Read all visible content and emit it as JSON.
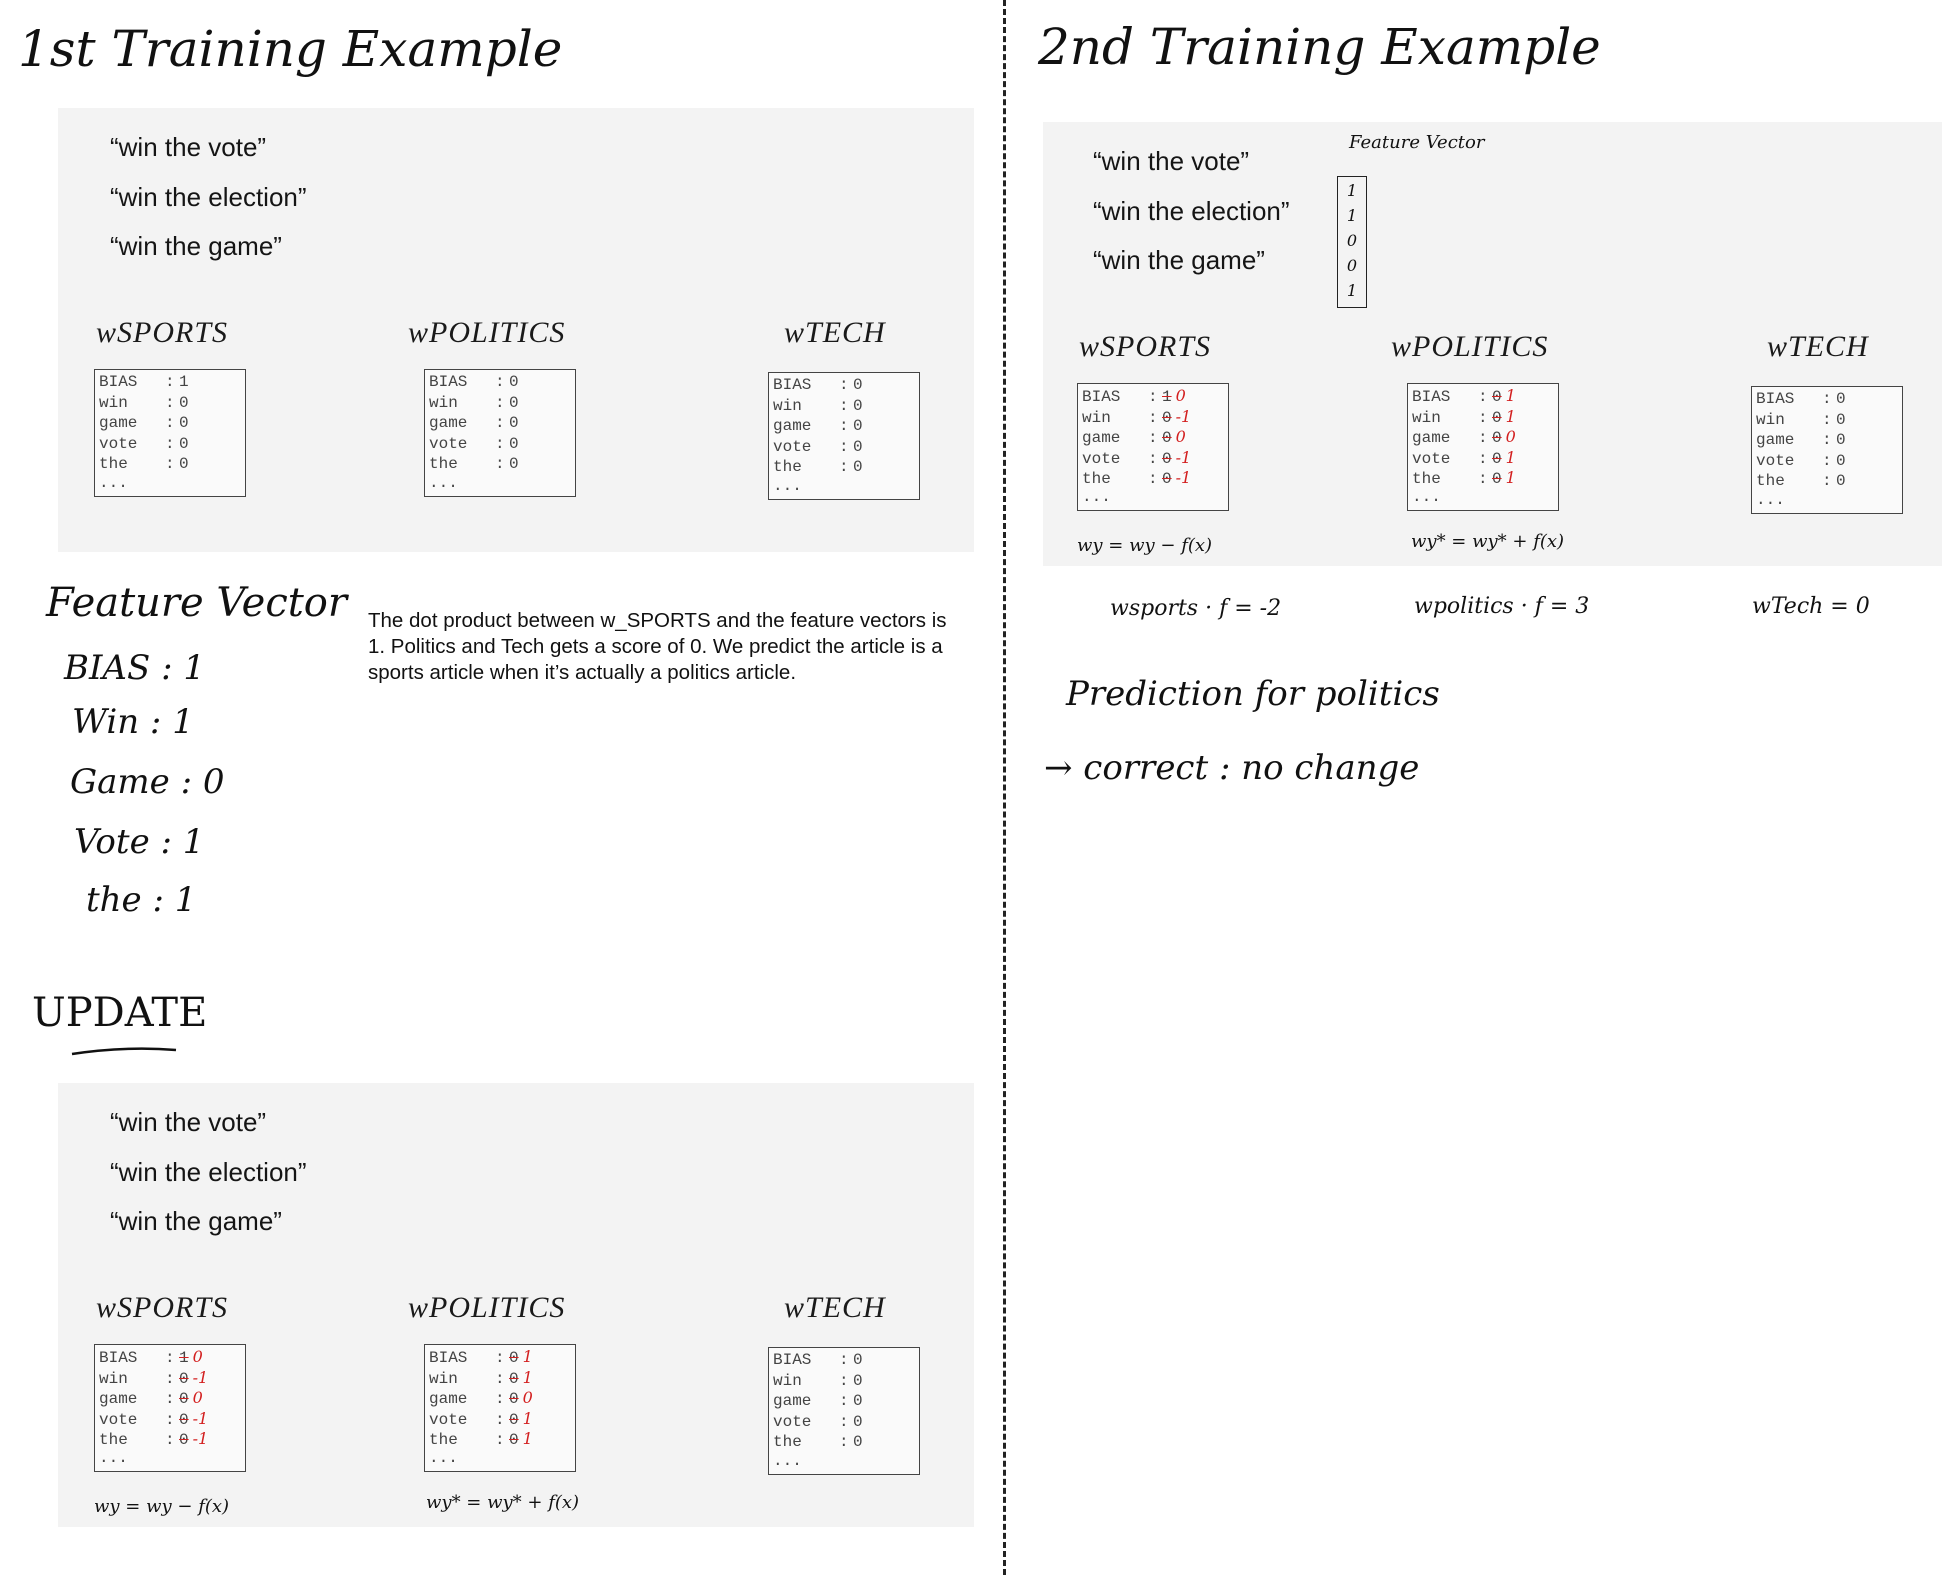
{
  "left": {
    "heading": "1st Training Example",
    "panel_top": {
      "phrases": [
        "“win the vote”",
        "“win the election”",
        "“win the game”"
      ],
      "weights": [
        {
          "label": "wSPORTS",
          "rows": [
            {
              "key": "BIAS",
              "val": "1"
            },
            {
              "key": "win",
              "val": "0"
            },
            {
              "key": "game",
              "val": "0"
            },
            {
              "key": "vote",
              "val": "0"
            },
            {
              "key": "the",
              "val": "0"
            }
          ]
        },
        {
          "label": "wPOLITICS",
          "rows": [
            {
              "key": "BIAS",
              "val": "0"
            },
            {
              "key": "win",
              "val": "0"
            },
            {
              "key": "game",
              "val": "0"
            },
            {
              "key": "vote",
              "val": "0"
            },
            {
              "key": "the",
              "val": "0"
            }
          ]
        },
        {
          "label": "wTECH",
          "rows": [
            {
              "key": "BIAS",
              "val": "0"
            },
            {
              "key": "win",
              "val": "0"
            },
            {
              "key": "game",
              "val": "0"
            },
            {
              "key": "vote",
              "val": "0"
            },
            {
              "key": "the",
              "val": "0"
            }
          ]
        }
      ],
      "ellipsis": "..."
    },
    "feature_vector": {
      "title": "Feature Vector",
      "items": [
        "BIAS : 1",
        "Win : 1",
        "Game : 0",
        "Vote : 1",
        "the : 1"
      ]
    },
    "explanation": "The dot product between w_SPORTS and the feature vectors is 1. Politics and Tech gets a score of 0. We predict the article is a sports article when it’s actually a politics article.",
    "update_heading": "UPDATE",
    "panel_bottom": {
      "phrases": [
        "“win the vote”",
        "“win the election”",
        "“win the game”"
      ],
      "weights": [
        {
          "label": "wSPORTS",
          "rows": [
            {
              "key": "BIAS",
              "old": "1",
              "new": "0"
            },
            {
              "key": "win",
              "old": "0",
              "new": "-1"
            },
            {
              "key": "game",
              "old": "0",
              "new": "0"
            },
            {
              "key": "vote",
              "old": "0",
              "new": "-1"
            },
            {
              "key": "the",
              "old": "0",
              "new": "-1"
            }
          ]
        },
        {
          "label": "wPOLITICS",
          "rows": [
            {
              "key": "BIAS",
              "old": "0",
              "new": "1"
            },
            {
              "key": "win",
              "old": "0",
              "new": "1"
            },
            {
              "key": "game",
              "old": "0",
              "new": "0"
            },
            {
              "key": "vote",
              "old": "0",
              "new": "1"
            },
            {
              "key": "the",
              "old": "0",
              "new": "1"
            }
          ]
        },
        {
          "label": "wTECH",
          "rows": [
            {
              "key": "BIAS",
              "val": "0"
            },
            {
              "key": "win",
              "val": "0"
            },
            {
              "key": "game",
              "val": "0"
            },
            {
              "key": "vote",
              "val": "0"
            },
            {
              "key": "the",
              "val": "0"
            }
          ]
        }
      ],
      "ellipsis": "...",
      "formula_sports": "wy = wy − f(x)",
      "formula_politics": "wy* = wy* + f(x)"
    }
  },
  "right": {
    "heading": "2nd Training Example",
    "feature_vector_label": "Feature Vector",
    "feature_vector_values": [
      "1",
      "1",
      "0",
      "0",
      "1"
    ],
    "panel": {
      "phrases": [
        "“win the vote”",
        "“win the election”",
        "“win the game”"
      ],
      "weights": [
        {
          "label": "wSPORTS",
          "rows": [
            {
              "key": "BIAS",
              "old": "1",
              "new": "0"
            },
            {
              "key": "win",
              "old": "0",
              "new": "-1"
            },
            {
              "key": "game",
              "old": "0",
              "new": "0"
            },
            {
              "key": "vote",
              "old": "0",
              "new": "-1"
            },
            {
              "key": "the",
              "old": "0",
              "new": "-1"
            }
          ]
        },
        {
          "label": "wPOLITICS",
          "rows": [
            {
              "key": "BIAS",
              "old": "0",
              "new": "1"
            },
            {
              "key": "win",
              "old": "0",
              "new": "1"
            },
            {
              "key": "game",
              "old": "0",
              "new": "0"
            },
            {
              "key": "vote",
              "old": "0",
              "new": "1"
            },
            {
              "key": "the",
              "old": "0",
              "new": "1"
            }
          ]
        },
        {
          "label": "wTECH",
          "rows": [
            {
              "key": "BIAS",
              "val": "0"
            },
            {
              "key": "win",
              "val": "0"
            },
            {
              "key": "game",
              "val": "0"
            },
            {
              "key": "vote",
              "val": "0"
            },
            {
              "key": "the",
              "val": "0"
            }
          ]
        }
      ],
      "ellipsis": "...",
      "formula_sports": "wy = wy − f(x)",
      "formula_politics": "wy* = wy* + f(x)"
    },
    "scores": [
      "wsports · f = -2",
      "wpolitics · f = 3",
      "wTech = 0"
    ],
    "note1": "Prediction for politics",
    "note2": "→ correct : no change"
  }
}
